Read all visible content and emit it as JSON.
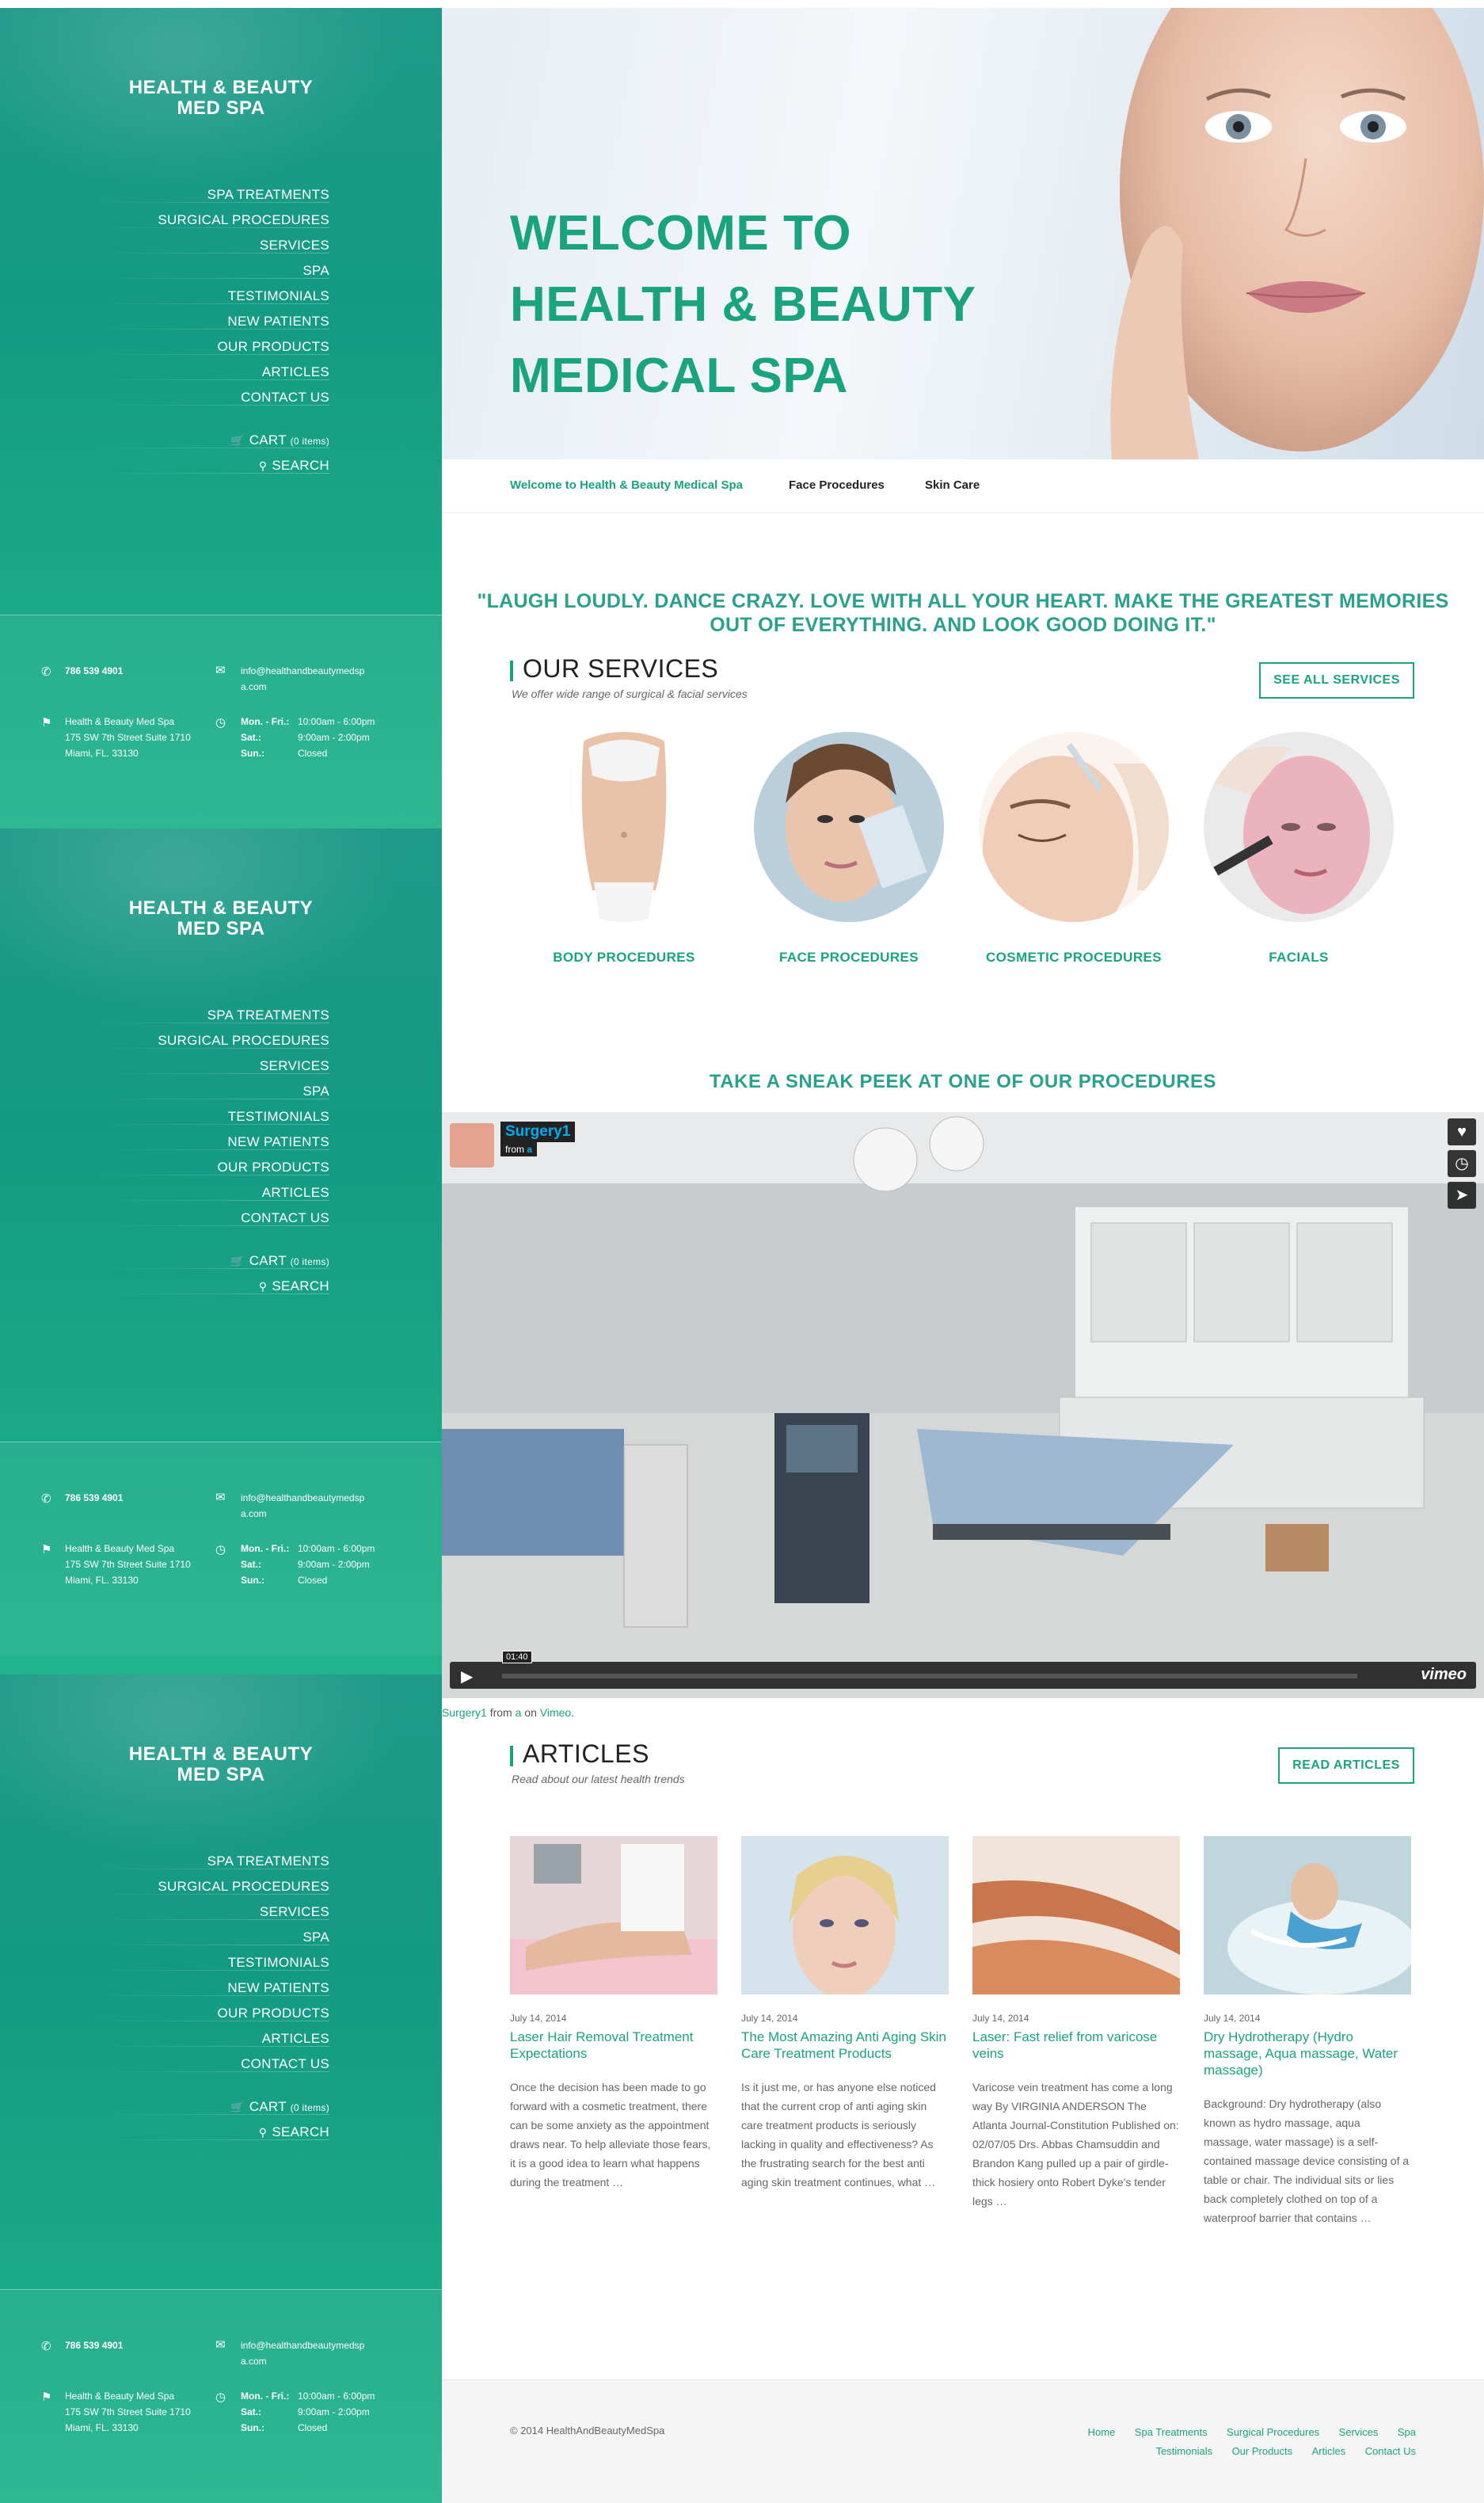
{
  "brand": {
    "line1": "HEALTH & BEAUTY",
    "line2": "MED SPA"
  },
  "nav": {
    "items": [
      "SPA TREATMENTS",
      "SURGICAL PROCEDURES",
      "SERVICES",
      "SPA",
      "TESTIMONIALS",
      "NEW PATIENTS",
      "OUR PRODUCTS",
      "ARTICLES",
      "CONTACT US"
    ],
    "cart_label": "CART",
    "cart_count": "(0 items)",
    "search_label": "SEARCH"
  },
  "contact": {
    "phone": "786 539 4901",
    "email_line1": "info@healthandbeautymedsp",
    "email_line2": "a.com",
    "address_line1": "Health & Beauty Med Spa",
    "address_line2": "175 SW 7th Street Suite 1710",
    "address_line3": "Miami, FL. 33130",
    "hours": [
      {
        "day": "Mon. - Fri.:",
        "time": "10:00am - 6:00pm"
      },
      {
        "day": "Sat.:",
        "time": "9:00am - 2:00pm"
      },
      {
        "day": "Sun.:",
        "time": "Closed"
      }
    ]
  },
  "hero": {
    "line1": "WELCOME TO",
    "line2": "HEALTH & BEAUTY",
    "line3": "MEDICAL SPA"
  },
  "tabs": [
    "Welcome to Health & Beauty Medical Spa",
    "Face Procedures",
    "Skin Care"
  ],
  "quote": "\"LAUGH LOUDLY. DANCE CRAZY. LOVE WITH ALL YOUR HEART. MAKE THE GREATEST MEMORIES OUT OF EVERYTHING. AND LOOK GOOD DOING IT.\"",
  "services": {
    "title": "OUR SERVICES",
    "subtitle": "We offer wide range of surgical & facial services",
    "button": "SEE ALL SERVICES",
    "items": [
      "BODY PROCEDURES",
      "FACE PROCEDURES",
      "COSMETIC PROCEDURES",
      "FACIALS"
    ]
  },
  "peek": "TAKE A SNEAK PEEK AT ONE OF OUR PROCEDURES",
  "video": {
    "title": "Surgery1",
    "from_label": "from",
    "from_user": "a",
    "time": "01:40",
    "brand": "vimeo",
    "progress": 0
  },
  "video_caption": {
    "title": "Surgery1",
    "from": " from ",
    "user": "a",
    "on": " on ",
    "site": "Vimeo",
    "end": "."
  },
  "articles": {
    "title": "ARTICLES",
    "subtitle": "Read about our latest health trends",
    "button": "READ ARTICLES",
    "items": [
      {
        "date": "July 14, 2014",
        "title": "Laser Hair Removal Treatment Expectations",
        "body": "Once the decision has been made to go forward with a cosmetic treatment, there can be some anxiety as the appointment draws near. To help alleviate those fears, it is a good idea to learn what happens during the treatment …"
      },
      {
        "date": "July 14, 2014",
        "title": "The Most Amazing Anti Aging Skin Care Treatment Products",
        "body": "Is it just me, or has anyone else noticed that the current crop of anti aging skin care treatment products is seriously lacking in quality and effectiveness? As the frustrating search for the best anti aging skin treatment continues, what …"
      },
      {
        "date": "July 14, 2014",
        "title": "Laser: Fast relief from varicose veins",
        "body": "Varicose vein treatment has come a long way   By VIRGINIA ANDERSON The Atlanta Journal-Constitution Published on: 02/07/05 Drs. Abbas Chamsuddin and Brandon Kang pulled up a pair of girdle-thick hosiery onto Robert Dyke's tender legs …"
      },
      {
        "date": "July 14, 2014",
        "title": "Dry Hydrotherapy (Hydro massage, Aqua massage, Water massage)",
        "body": "Background: Dry hydrotherapy (also known as hydro massage, aqua massage, water massage) is a self-contained massage device consisting of a table or chair. The individual sits or lies back completely clothed on top of a waterproof barrier that contains …"
      }
    ]
  },
  "footer": {
    "copyright": "© 2014 HealthAndBeautyMedSpa",
    "links": [
      "Home",
      "Spa Treatments",
      "Surgical Procedures",
      "Services",
      "Spa",
      "Testimonials",
      "Our Products",
      "Articles",
      "Contact Us"
    ]
  }
}
